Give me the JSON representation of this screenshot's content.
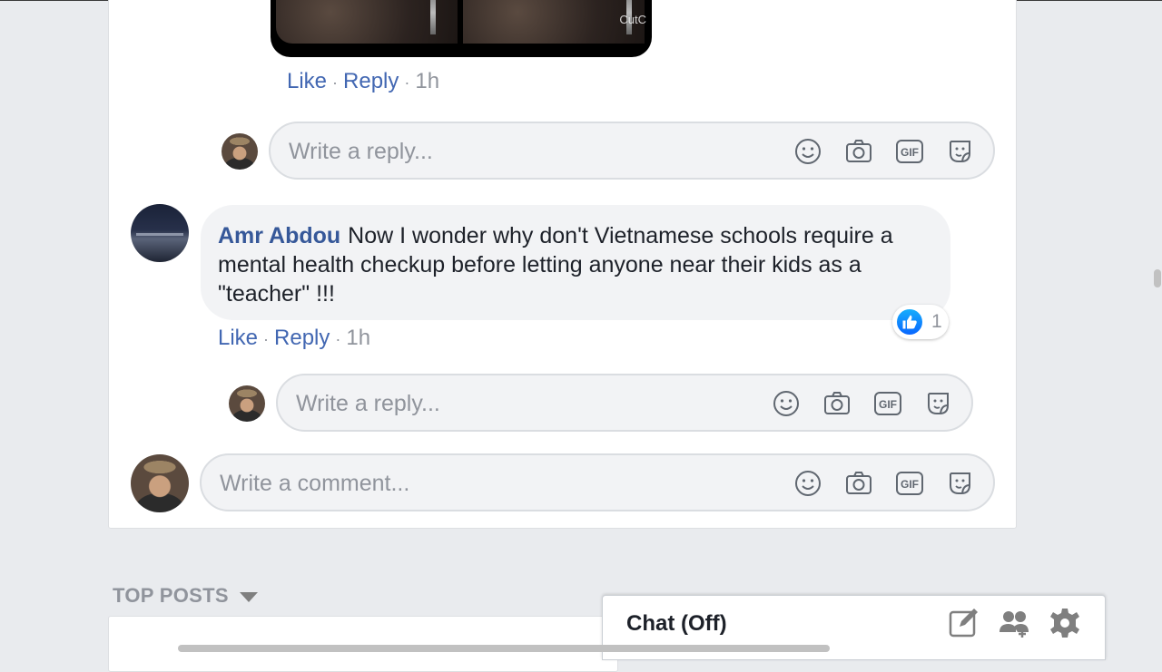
{
  "previous_comment": {
    "media_watermark": "CutC",
    "actions": {
      "like": "Like",
      "reply": "Reply",
      "time": "1h"
    },
    "reply_box": {
      "placeholder": "Write a reply..."
    }
  },
  "comment": {
    "author": "Amr Abdou",
    "text": "Now I wonder why don't Vietnamese schools require a mental health checkup before letting anyone near their kids as a \"teacher\" !!!",
    "reaction": {
      "icon": "like-icon",
      "count": "1"
    },
    "actions": {
      "like": "Like",
      "reply": "Reply",
      "time": "1h"
    },
    "reply_box": {
      "placeholder": "Write a reply..."
    }
  },
  "comment_box": {
    "placeholder": "Write a comment..."
  },
  "input_icons": [
    "emoji-icon",
    "camera-icon",
    "gif-icon",
    "sticker-icon"
  ],
  "section_header": {
    "label": "TOP POSTS"
  },
  "chat": {
    "title": "Chat (Off)",
    "tools": [
      "compose-icon",
      "group-icon",
      "gear-icon"
    ]
  },
  "colors": {
    "link": "#4267b2",
    "author": "#365899",
    "like_blue": "#0866ff"
  }
}
